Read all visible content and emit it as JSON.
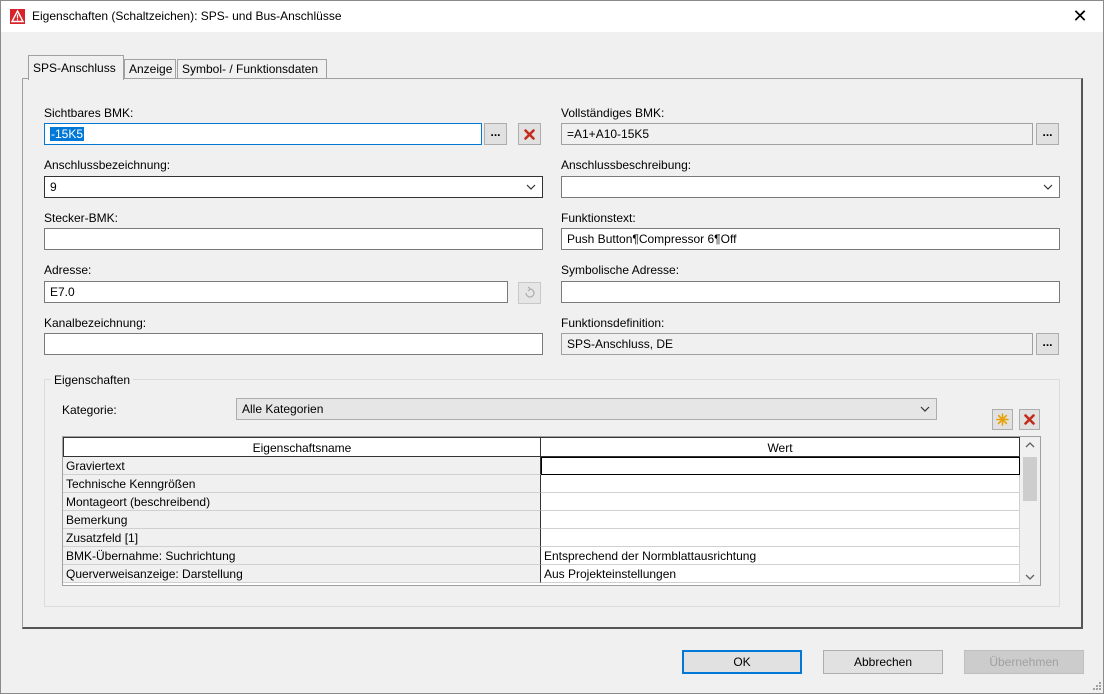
{
  "window": {
    "title": "Eigenschaften (Schaltzeichen): SPS- und Bus-Anschlüsse",
    "close": "✕"
  },
  "tabs": [
    {
      "label": "SPS-Anschluss"
    },
    {
      "label": "Anzeige"
    },
    {
      "label": "Symbol- / Funktionsdaten"
    }
  ],
  "form": {
    "sichtbares_bmk": {
      "label": "Sichtbares BMK:",
      "value": "-15K5",
      "more": "...",
      "clear": "✖"
    },
    "vollstaendiges_bmk": {
      "label": "Vollständiges BMK:",
      "value": "=A1+A10-15K5",
      "more": "..."
    },
    "anschlussbezeichnung": {
      "label": "Anschlussbezeichnung:",
      "value": "9"
    },
    "anschlussbeschreibung": {
      "label": "Anschlussbeschreibung:",
      "value": ""
    },
    "stecker_bmk": {
      "label": "Stecker-BMK:",
      "value": ""
    },
    "funktionstext": {
      "label": "Funktionstext:",
      "value": "Push Button¶Compressor 6¶Off"
    },
    "adresse": {
      "label": "Adresse:",
      "value": "E7.0",
      "icon": "refresh-address-icon"
    },
    "symbolische_adresse": {
      "label": "Symbolische Adresse:",
      "value": ""
    },
    "kanalbezeichnung": {
      "label": "Kanalbezeichnung:",
      "value": ""
    },
    "funktionsdefinition": {
      "label": "Funktionsdefinition:",
      "value": "SPS-Anschluss, DE",
      "more": "..."
    }
  },
  "properties": {
    "group_label": "Eigenschaften",
    "kategorie_label": "Kategorie:",
    "kategorie_value": "Alle Kategorien",
    "columns": [
      "Eigenschaftsname",
      "Wert"
    ],
    "rows": [
      {
        "name": "Graviertext",
        "value": ""
      },
      {
        "name": "Technische Kenngrößen",
        "value": ""
      },
      {
        "name": "Montageort (beschreibend)",
        "value": ""
      },
      {
        "name": "Bemerkung",
        "value": ""
      },
      {
        "name": "Zusatzfeld [1]",
        "value": ""
      },
      {
        "name": "BMK-Übernahme: Suchrichtung",
        "value": "Entsprechend der Normblattausrichtung"
      },
      {
        "name": "Querverweisanzeige: Darstellung",
        "value": "Aus Projekteinstellungen"
      }
    ]
  },
  "buttons": {
    "ok": "OK",
    "cancel": "Abbrechen",
    "apply": "Übernehmen"
  },
  "colors": {
    "accent": "#0078d7",
    "delete_red": "#c42b1c",
    "new_star": "#e8a000"
  }
}
